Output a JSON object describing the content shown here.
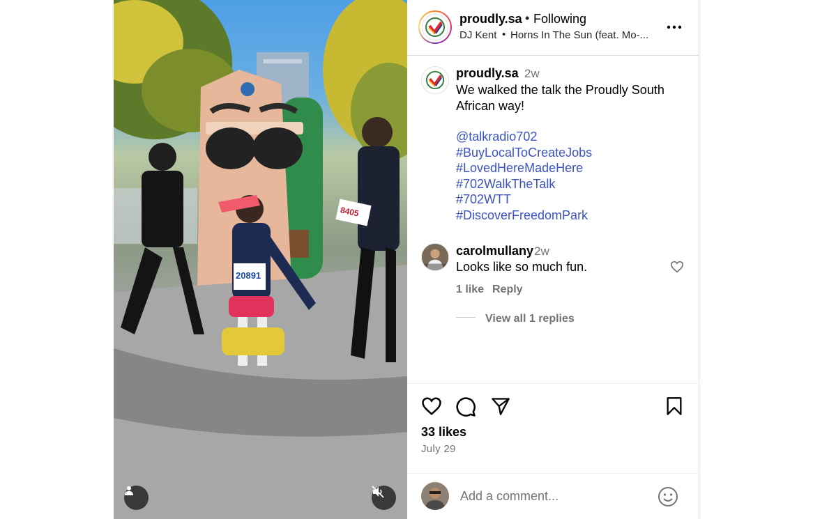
{
  "post": {
    "username": "proudly.sa",
    "separator": "•",
    "follow_status": "Following",
    "audio_artist": "DJ Kent",
    "audio_bullet": "•",
    "audio_title": "Horns In The Sun (feat. Mo-...",
    "more_icon": "more-horizontal-icon"
  },
  "caption": {
    "username": "proudly.sa",
    "time": "2w",
    "text": "We walked the talk the Proudly South African way!",
    "hashtags": [
      "@talkradio702",
      "#BuyLocalToCreateJobs",
      "#LovedHereMadeHere",
      "#702WalkTheTalk",
      "#702WTT",
      "#DiscoverFreedomPark"
    ]
  },
  "comment": {
    "username": "carolmullany",
    "time": "2w",
    "text": "Looks like so much fun.",
    "likes": "1 like",
    "reply": "Reply",
    "view_replies": "View all 1 replies"
  },
  "actions": {
    "likes": "33 likes",
    "date": "July 29",
    "icons": [
      "heart-icon",
      "comment-icon",
      "share-icon",
      "bookmark-icon"
    ]
  },
  "add_comment": {
    "placeholder": "Add a comment..."
  },
  "media": {
    "bib_numbers": [
      "8405",
      "20891"
    ],
    "icons": [
      "user-tag-icon",
      "muted-speaker-icon"
    ]
  },
  "colors": {
    "link": "#3b53c4",
    "secondary_text": "#737373",
    "border": "#dbdbdb"
  }
}
